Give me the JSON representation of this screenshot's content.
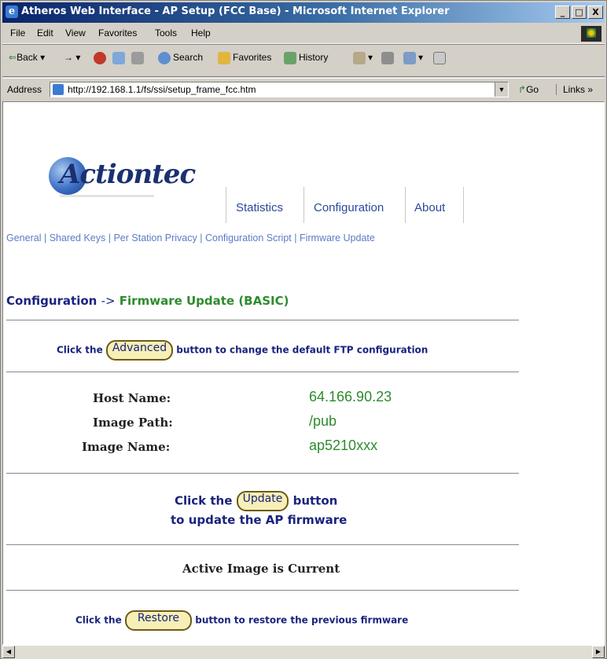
{
  "window": {
    "title": "Atheros Web Interface - AP Setup (FCC Base) - Microsoft Internet Explorer",
    "minimize": "_",
    "maximize": "□",
    "close": "X"
  },
  "menu": [
    "File",
    "Edit",
    "View",
    "Favorites",
    "Tools",
    "Help"
  ],
  "toolbar": {
    "back": "Back",
    "search": "Search",
    "favorites": "Favorites",
    "history": "History"
  },
  "address": {
    "label": "Address",
    "url": "http://192.168.1.1/fs/ssi/setup_frame_fcc.htm",
    "go": "Go",
    "links": "Links"
  },
  "brand": {
    "logo_text": "Actiontec"
  },
  "topnav": [
    "Statistics",
    "Configuration",
    "About"
  ],
  "subnav": [
    "General",
    "Shared Keys",
    "Per Station Privacy",
    "Configuration Script",
    "Firmware Update"
  ],
  "subnav_sep": " | ",
  "breadcrumb": {
    "section": "Configuration",
    "arrow": "->",
    "page": "Firmware Update (BASIC)"
  },
  "advanced": {
    "prefix": "Click the",
    "button": "Advanced",
    "suffix": "button to change the default FTP configuration"
  },
  "ftp": {
    "host_label": "Host Name:",
    "host_value": "64.166.90.23",
    "path_label": "Image Path:",
    "path_value": "/pub",
    "name_label": "Image Name:",
    "name_value": "ap5210xxx"
  },
  "update": {
    "prefix": "Click the",
    "button": "Update",
    "suffix": "button",
    "line2": "to update the AP firmware"
  },
  "status": "Active Image is Current",
  "restore": {
    "prefix": "Click the",
    "button": "Restore",
    "suffix": "button to restore the previous firmware"
  },
  "colors": {
    "link": "#2a4a9c",
    "green": "#2e8b2e",
    "navy": "#1a237e"
  }
}
